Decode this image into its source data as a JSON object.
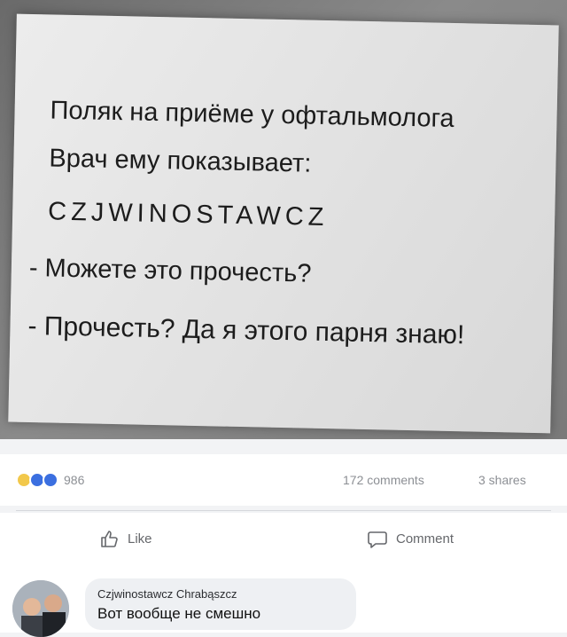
{
  "post": {
    "image_text": {
      "line1": "Поляк на приёме у офтальмолога",
      "line2": "Врач ему показывает:",
      "line3": "CZJWINOSTAWCZ",
      "line4": "- Можете это прочесть?",
      "line5": "- Прочесть? Да я этого парня знаю!"
    }
  },
  "reactions": {
    "count": "986",
    "comments": "172 comments",
    "shares": "3 shares",
    "icons": [
      "haha-icon",
      "like-icon",
      "love-icon"
    ]
  },
  "actions": {
    "like_label": "Like",
    "comment_label": "Comment"
  },
  "comment": {
    "author": "Czjwinostawcz Chrabąszcz",
    "text": "Вот вообще не смешно"
  },
  "colors": {
    "background": "#f2f3f5",
    "secondary_text": "#65676b",
    "bubble": "#eef0f3"
  }
}
